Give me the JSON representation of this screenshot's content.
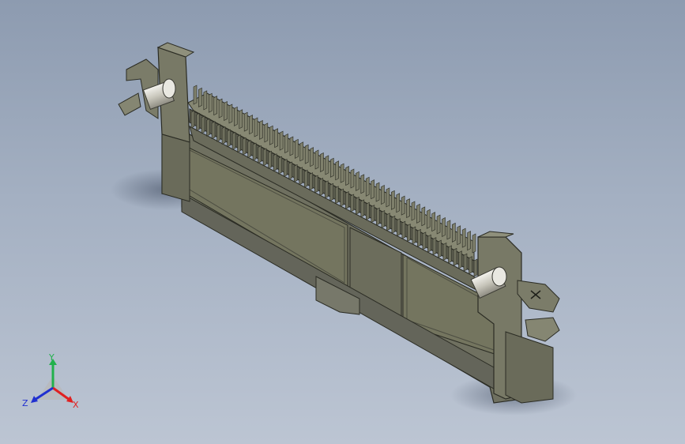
{
  "viewport": {
    "background_top": "#8d9bb0",
    "background_bottom": "#bcc5d3"
  },
  "model": {
    "name": "connector-3d-model",
    "body_color": "#6f7060",
    "body_shade": "#5d5e50",
    "body_light": "#878873",
    "edge_color": "#2b2c24",
    "metal_color": "#d8d6cc"
  },
  "triad": {
    "x_label": "X",
    "y_label": "Y",
    "z_label": "Z",
    "x_color": "#e02020",
    "y_color": "#22b14c",
    "z_color": "#2030d0"
  }
}
